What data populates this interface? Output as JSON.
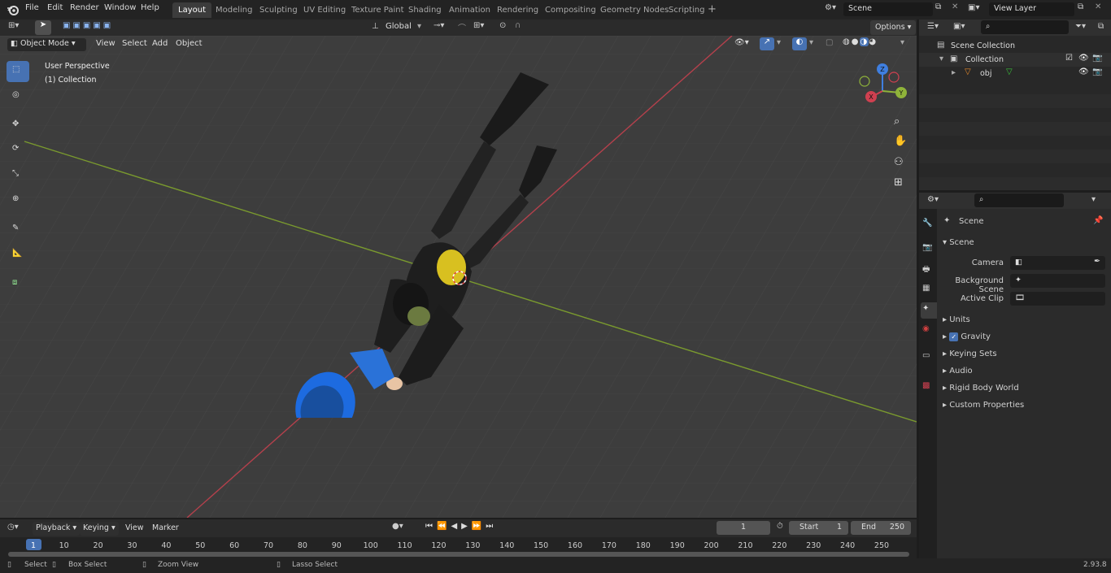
{
  "menu": {
    "file": "File",
    "edit": "Edit",
    "render": "Render",
    "window": "Window",
    "help": "Help"
  },
  "workspaces": [
    "Layout",
    "Modeling",
    "Sculpting",
    "UV Editing",
    "Texture Paint",
    "Shading",
    "Animation",
    "Rendering",
    "Compositing",
    "Geometry Nodes",
    "Scripting"
  ],
  "scene_field": "Scene",
  "view_layer_field": "View Layer",
  "header": {
    "transform_orientation": "Global",
    "options": "Options"
  },
  "viewport_header": {
    "mode": "Object Mode",
    "view": "View",
    "select": "Select",
    "add": "Add",
    "object": "Object"
  },
  "viewport": {
    "perspective_label": "User Perspective",
    "collection_label": "(1) Collection",
    "axis_x": "X",
    "axis_y": "Y",
    "axis_z": "Z"
  },
  "outliner": {
    "scene_collection": "Scene Collection",
    "collection": "Collection",
    "obj": "obj"
  },
  "properties": {
    "header": "Scene",
    "panel_scene": "Scene",
    "camera_label": "Camera",
    "background_scene_label": "Background Scene",
    "active_clip_label": "Active Clip",
    "panels": [
      "Units",
      "Gravity",
      "Keying Sets",
      "Audio",
      "Rigid Body World",
      "Custom Properties"
    ]
  },
  "timeline": {
    "playback": "Playback",
    "keying": "Keying",
    "view": "View",
    "marker": "Marker",
    "current_frame": "1",
    "start_label": "Start",
    "start_value": "1",
    "end_label": "End",
    "end_value": "250",
    "ticks": [
      "1",
      "10",
      "20",
      "30",
      "40",
      "50",
      "60",
      "70",
      "80",
      "90",
      "100",
      "110",
      "120",
      "130",
      "140",
      "150",
      "160",
      "170",
      "180",
      "190",
      "200",
      "210",
      "220",
      "230",
      "240",
      "250"
    ]
  },
  "status": {
    "select": "Select",
    "box_select": "Box Select",
    "zoom_view": "Zoom View",
    "lasso_select": "Lasso Select",
    "version": "2.93.8"
  },
  "colors": {
    "accent": "#4772b3",
    "x_axis": "#d04050",
    "y_axis": "#8fb33a",
    "z_axis": "#3f7fe0"
  }
}
